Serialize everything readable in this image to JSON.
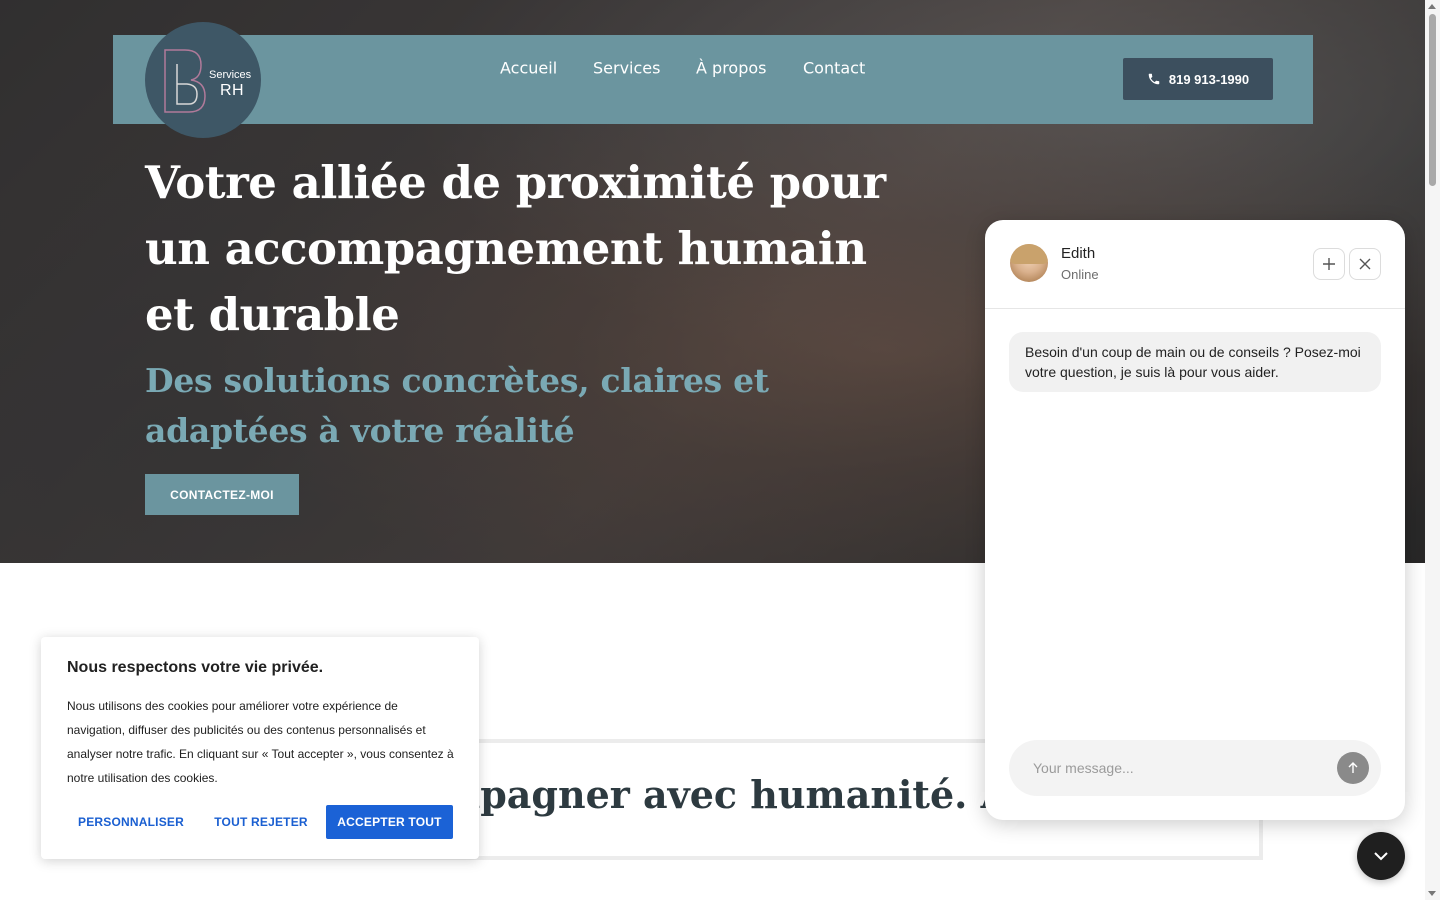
{
  "brand": {
    "logo_services": "Services",
    "logo_rh": "RH",
    "colors": {
      "primary": "#6b959f",
      "dark": "#3c4f5e",
      "subtitle": "#7aa9b4",
      "accept": "#1b62d6"
    }
  },
  "nav": {
    "items": [
      {
        "label": "Accueil"
      },
      {
        "label": "Services"
      },
      {
        "label": "À propos"
      },
      {
        "label": "Contact"
      }
    ],
    "phone": "819 913-1990",
    "phone_icon": "phone-icon"
  },
  "hero": {
    "title": "Votre alliée de proximité pour un accompagnement humain et durable",
    "subtitle": "Des solutions concrètes, claires et adaptées à votre réalité",
    "cta": "CONTACTEZ-MOI"
  },
  "banner": {
    "text": "mpagner avec humanité. Agir"
  },
  "cookie": {
    "title": "Nous respectons votre vie privée.",
    "body": "Nous utilisons des cookies pour améliorer votre expérience de navigation, diffuser des publicités ou des contenus personnalisés et analyser notre trafic. En cliquant sur « Tout accepter », vous consentez à notre utilisation des cookies.",
    "customize": "PERSONNALISER",
    "reject": "TOUT REJETER",
    "accept": "ACCEPTER TOUT"
  },
  "chat": {
    "agent_name": "Edith",
    "status": "Online",
    "message": "Besoin d'un coup de main ou de conseils ? Posez-moi votre question, je suis là pour vous aider.",
    "input_placeholder": "Your message..."
  }
}
